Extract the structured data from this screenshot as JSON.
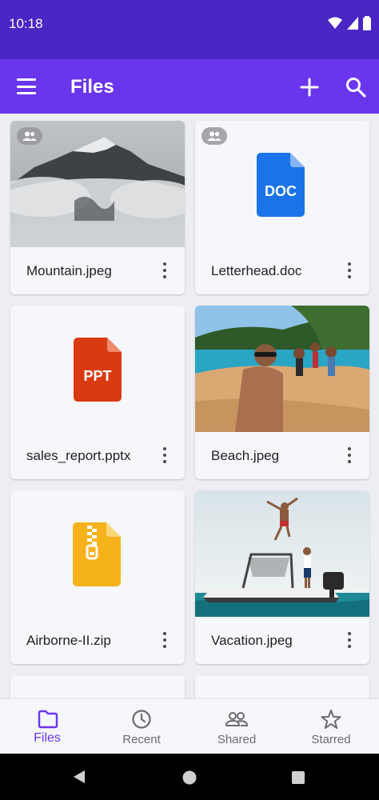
{
  "status_bar": {
    "time": "10:18"
  },
  "app_bar": {
    "title": "Files",
    "menu_icon": "menu-icon",
    "add_icon": "add-icon",
    "search_icon": "search-icon"
  },
  "files": [
    {
      "name": "Mountain.jpeg",
      "type": "image",
      "shared": true
    },
    {
      "name": "Letterhead.doc",
      "type": "doc",
      "icon_label": "DOC",
      "icon_color": "#1a73e8",
      "shared": true
    },
    {
      "name": "sales_report.pptx",
      "type": "ppt",
      "icon_label": "PPT",
      "icon_color": "#d93a12",
      "shared": false
    },
    {
      "name": "Beach.jpeg",
      "type": "image",
      "shared": false
    },
    {
      "name": "Airborne-II.zip",
      "type": "zip",
      "icon_color": "#f6b21b",
      "shared": false
    },
    {
      "name": "Vacation.jpeg",
      "type": "image",
      "shared": false
    }
  ],
  "bottom_nav": {
    "items": [
      {
        "label": "Files",
        "icon": "folder-icon",
        "active": true
      },
      {
        "label": "Recent",
        "icon": "clock-icon",
        "active": false
      },
      {
        "label": "Shared",
        "icon": "people-icon",
        "active": false
      },
      {
        "label": "Starred",
        "icon": "star-icon",
        "active": false
      }
    ]
  },
  "colors": {
    "status_bar": "#4a26c4",
    "app_bar": "#6a35ec",
    "accent": "#6a35ec"
  }
}
